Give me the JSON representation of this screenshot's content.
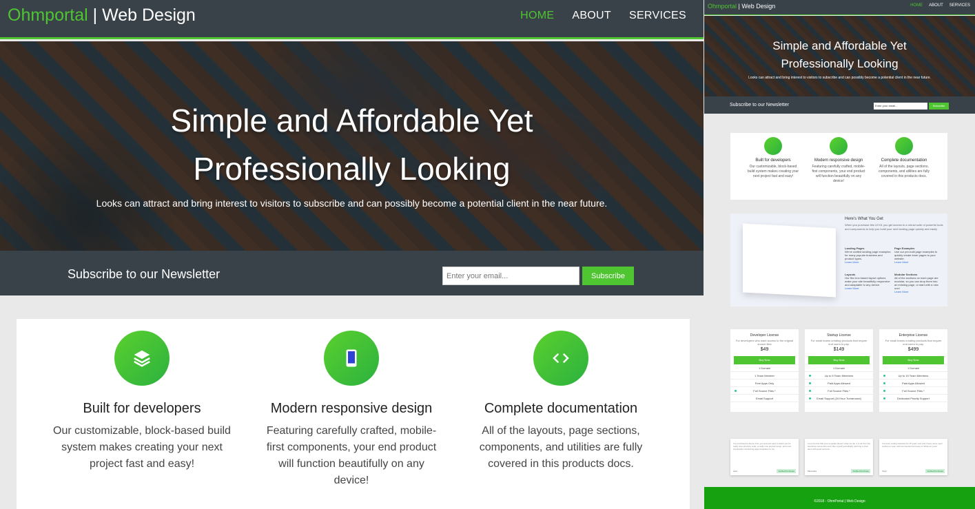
{
  "header": {
    "brand_accent": "Ohmportal",
    "brand_rest": " | Web Design",
    "nav": [
      "HOME",
      "ABOUT",
      "SERVICES"
    ]
  },
  "hero": {
    "title_line1": "Simple and Affordable Yet",
    "title_line2": "Professionally Looking",
    "subtitle": "Looks can attract and bring interest to visitors to subscribe and can possibly become a potential client in the near future."
  },
  "newsletter": {
    "title": "Subscribe to our Newsletter",
    "placeholder": "Enter your email...",
    "button": "Subscribe"
  },
  "features": [
    {
      "icon": "layers-icon",
      "title": "Built for developers",
      "text": "Our customizable, block-based build system makes creating your next project fast and easy!"
    },
    {
      "icon": "mobile-icon",
      "title": "Modern responsive design",
      "text": "Featuring carefully crafted, mobile-first components, your end product will function beautifully on any device!"
    },
    {
      "icon": "code-icon",
      "title": "Complete documentation",
      "text": "All of the layouts, page sections, components, and utilities are fully covered in this products docs."
    }
  ],
  "mini": {
    "here_title": "Here's What You Get",
    "here_text": "When you purchase this UI Kit, you get access to a robust suite of powerful tools and components to help you build your next landing page quickly and easily.",
    "items": [
      {
        "title": "Landing Pages",
        "text": "We've crafted landing page examples for many popular business and product types.",
        "link": "Learn More"
      },
      {
        "title": "Page Examples",
        "text": "Use our pre-built page examples to quickly create inner pages to your website.",
        "link": "Learn More"
      },
      {
        "title": "Layouts",
        "text": "Our flex box based layout options make your site beautifully responsive and adaptable to any device.",
        "link": "Learn More"
      },
      {
        "title": "Modular Sections",
        "text": "All of the sections on each page are modular, so you can drop them into an existing page, or start with a new one!",
        "link": "Learn More"
      }
    ],
    "pricing": [
      {
        "name": "Developer License",
        "desc": "For developers who want access to the original source files",
        "price": "$49",
        "button": "Buy Now",
        "features": [
          {
            "t": "1 Domain",
            "on": false
          },
          {
            "t": "1 Team Member",
            "on": false
          },
          {
            "t": "Free Apps Only",
            "on": false
          },
          {
            "t": "Full Source Files *",
            "on": true
          },
          {
            "t": "Email Support",
            "on": false
          }
        ]
      },
      {
        "name": "Startup License",
        "desc": "For small teams creating products that require end users to pay.",
        "price": "$149",
        "button": "Buy Now",
        "features": [
          {
            "t": "1 Domain",
            "on": false
          },
          {
            "t": "Up to 5 Team Members",
            "on": true
          },
          {
            "t": "Paid Apps Allowed",
            "on": true
          },
          {
            "t": "Full Source Files *",
            "on": true
          },
          {
            "t": "Email Support (24 Hour Turnaround)",
            "on": true
          }
        ]
      },
      {
        "name": "Enterprise License",
        "desc": "For small teams creating products that require end users to pay.",
        "price": "$499",
        "button": "Buy Now",
        "features": [
          {
            "t": "1 Domain",
            "on": false
          },
          {
            "t": "Up to 15 Team Members",
            "on": true
          },
          {
            "t": "Paid Apps Allowed",
            "on": true
          },
          {
            "t": "Full Source Files *",
            "on": true
          },
          {
            "t": "Dedicated Priority Support",
            "on": true
          }
        ]
      }
    ],
    "testimonials": [
      {
        "text": "I've purchased a theme from you and just want to thank you for really nice structure code, a really nice product setup, and most importantly introducing page templates to me.",
        "name": "Lara",
        "badge": "Verified Purchase"
      },
      {
        "text": "Love the fact that your template doesn't stray too far. It is all from the bootstrap convention and I like myself periodically referring to their docs with great success.",
        "name": "Mercedes",
        "badge": "Verified Purchase"
      },
      {
        "text": "I've been coding websites for 15 years now and I have never seen coding so neat, well commented and easy to follow as yours.",
        "name": "Voytr",
        "badge": "Verified Purchase"
      }
    ],
    "footer": "©2018 - OhmPortal | Web Design"
  }
}
